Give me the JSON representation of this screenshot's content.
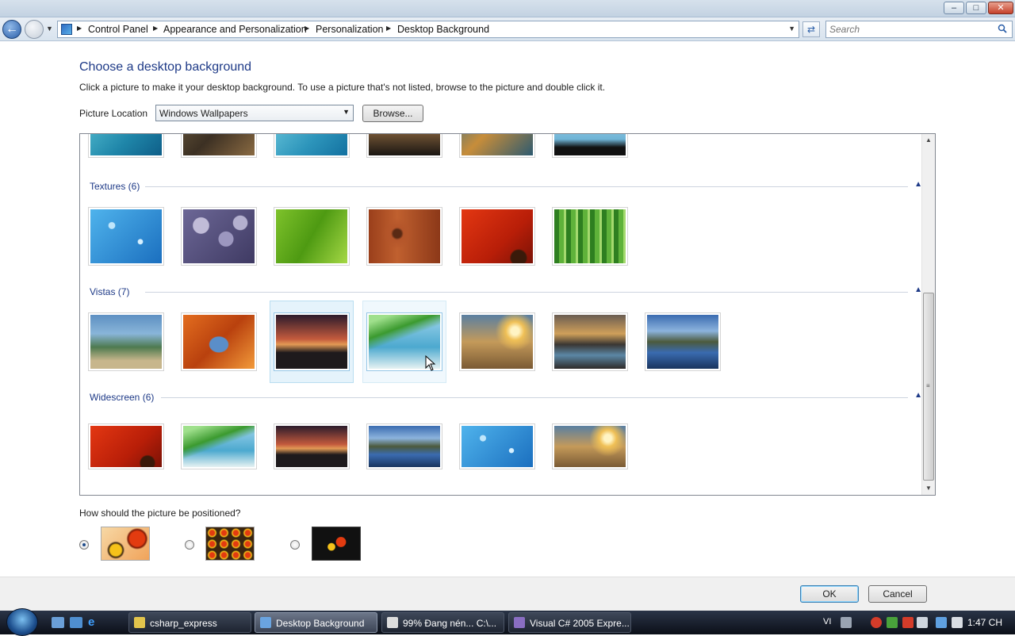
{
  "window": {
    "minimize_glyph": "–",
    "maximize_glyph": "□",
    "close_glyph": "✕"
  },
  "nav": {
    "back_glyph": "←",
    "breadcrumb": [
      "Control Panel",
      "Appearance and Personalization",
      "Personalization",
      "Desktop Background"
    ],
    "refresh_glyph": "⇄",
    "search_placeholder": "Search"
  },
  "content": {
    "title": "Choose a desktop background",
    "description": "Click a picture to make it your desktop background. To use a picture that's not listed, browse to the picture and double click it.",
    "picture_location_label": "Picture Location",
    "picture_location_value": "Windows Wallpapers",
    "browse_label": "Browse..."
  },
  "groups": [
    {
      "title": "Textures (6)"
    },
    {
      "title": "Vistas (7)"
    },
    {
      "title": "Widescreen (6)"
    }
  ],
  "positioning": {
    "label": "How should the picture be positioned?",
    "selected": "fit"
  },
  "dialog": {
    "ok_label": "OK",
    "cancel_label": "Cancel"
  },
  "taskbar": {
    "tasks": [
      {
        "label": "csharp_express",
        "active": false
      },
      {
        "label": "Desktop Background",
        "active": true
      },
      {
        "label": "99% Đang nén... C:\\...",
        "active": false
      },
      {
        "label": "Visual C# 2005 Expre...",
        "active": false
      }
    ],
    "language": "VI",
    "clock": "1:47 CH"
  },
  "colors": {
    "accent_blue": "#1e3a87",
    "taskbar_dark": "#0b0f18"
  }
}
